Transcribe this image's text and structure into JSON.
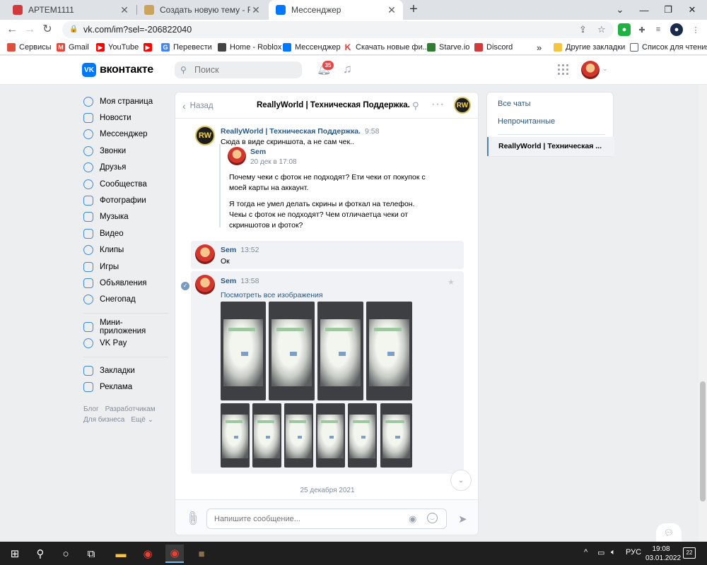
{
  "browser": {
    "tabs": [
      {
        "title": "АРТЕМ1111",
        "icon": "badge-icon",
        "active": false
      },
      {
        "title": "Создать новую тему - ReallyWo",
        "icon": "reallyworld-icon",
        "active": false
      },
      {
        "title": "Мессенджер",
        "icon": "messenger-icon",
        "active": true
      }
    ],
    "url": "vk.com/im?sel=-206822040",
    "bookmarks": [
      "Сервисы",
      "Gmail",
      "YouTube",
      "Перевести",
      "Home - Roblox",
      "Мессенджер",
      "Скачать новые фи...",
      "Starve.io",
      "Discord"
    ],
    "bookmarks_more": "»",
    "other_bookmarks": "Другие закладки",
    "reading_list": "Список для чтения"
  },
  "vk": {
    "logo": "вконтакте",
    "search_placeholder": "Поиск",
    "notifications_count": "35",
    "menu": [
      "Моя страница",
      "Новости",
      "Мессенджер",
      "Звонки",
      "Друзья",
      "Сообщества",
      "Фотографии",
      "Музыка",
      "Видео",
      "Клипы",
      "Игры",
      "Объявления",
      "Снегопад"
    ],
    "menu2": [
      "Мини-приложения",
      "VK Pay"
    ],
    "menu3": [
      "Закладки",
      "Реклама"
    ],
    "footer": [
      "Блог",
      "Разработчикам",
      "Для бизнеса",
      "Ещё ⌄"
    ]
  },
  "chat": {
    "back_label": "Назад",
    "title": "ReallyWorld | Техническая Поддержка.",
    "messages": [
      {
        "author": "ReallyWorld | Техническая Поддержка.",
        "time": "9:58",
        "text": "Сюда в виде скриншота, а не сам чек..",
        "forwarded": {
          "author": "Sem",
          "date": "20 дек в 17:08",
          "text1": "Почему чеки с фоток не подходят? Ети чеки от покупок с моей карты на аккаунт.",
          "text2": "Я тогда не умел делать скрины и фоткал на телефон. Чекы с фоток не подходят? Чем отличаетца чеки от скриншотов и фоток?"
        }
      },
      {
        "author": "Sem",
        "time": "13:52",
        "text": "Ок"
      },
      {
        "author": "Sem",
        "time": "13:58",
        "text": "Посмотреть все изображения"
      }
    ],
    "date_separator": "25 декабря 2021",
    "input_placeholder": "Напишите сообщение..."
  },
  "right_panel": {
    "all_chats": "Все чаты",
    "unread": "Непрочитанные",
    "active_chat": "ReallyWorld | Техническая ..."
  },
  "taskbar": {
    "lang": "РУС",
    "time": "19:08",
    "date": "03.01.2022",
    "notifications": "22"
  }
}
